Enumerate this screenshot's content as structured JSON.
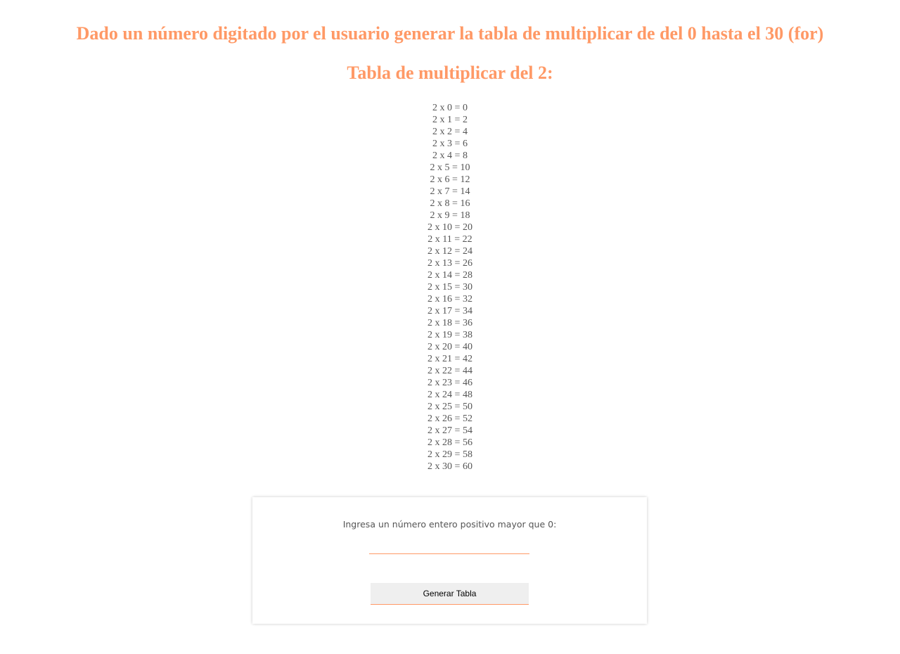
{
  "header": {
    "title": "Dado un número digitado por el usuario generar la tabla de multiplicar de del 0 hasta el 30 (for)",
    "subtitle": "Tabla de multiplicar del 2:"
  },
  "table": {
    "rows": [
      "2 x 0 = 0",
      "2 x 1 = 2",
      "2 x 2 = 4",
      "2 x 3 = 6",
      "2 x 4 = 8",
      "2 x 5 = 10",
      "2 x 6 = 12",
      "2 x 7 = 14",
      "2 x 8 = 16",
      "2 x 9 = 18",
      "2 x 10 = 20",
      "2 x 11 = 22",
      "2 x 12 = 24",
      "2 x 13 = 26",
      "2 x 14 = 28",
      "2 x 15 = 30",
      "2 x 16 = 32",
      "2 x 17 = 34",
      "2 x 18 = 36",
      "2 x 19 = 38",
      "2 x 20 = 40",
      "2 x 21 = 42",
      "2 x 22 = 44",
      "2 x 23 = 46",
      "2 x 24 = 48",
      "2 x 25 = 50",
      "2 x 26 = 52",
      "2 x 27 = 54",
      "2 x 28 = 56",
      "2 x 29 = 58",
      "2 x 30 = 60"
    ]
  },
  "form": {
    "label": "Ingresa un número entero positivo mayor que 0:",
    "input_value": "",
    "input_placeholder": "",
    "button_label": "Generar Tabla"
  },
  "colors": {
    "accent": "#ff9966",
    "text": "#555555",
    "button_bg": "#efefef"
  }
}
